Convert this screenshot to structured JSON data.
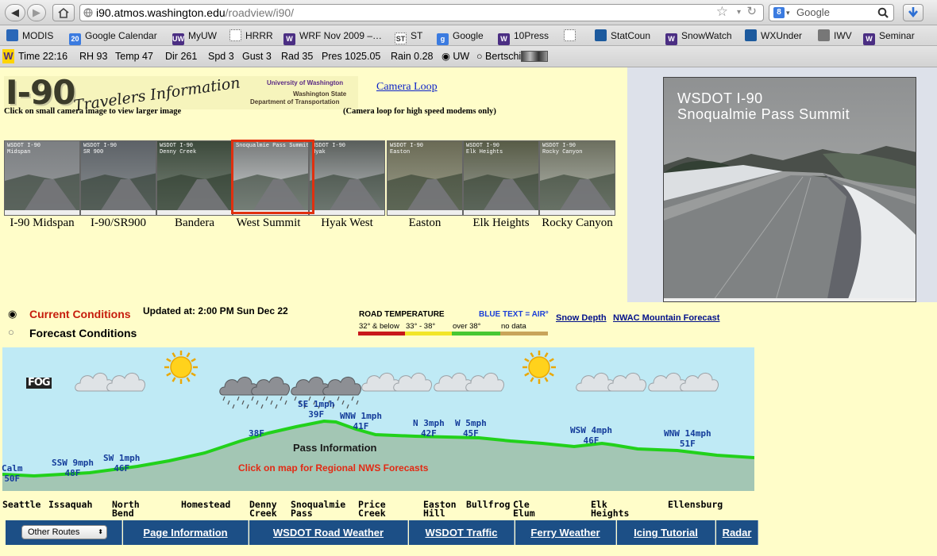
{
  "browser": {
    "url_host": "i90.atmos.washington.edu",
    "url_path": "/roadview/i90/",
    "search_placeholder": "Google"
  },
  "bookmarks": [
    {
      "label": "MODIS",
      "icon": "modis-icon",
      "color": "#2a67b8"
    },
    {
      "label": "Google Calendar",
      "icon": "calendar-icon",
      "color": "#3b7be0",
      "badge": "20"
    },
    {
      "label": "MyUW",
      "icon": "uw-icon",
      "color": "#4b2e83",
      "badge": "UW"
    },
    {
      "label": "HRRR",
      "icon": "dotted-page-icon",
      "color": "#ffffff"
    },
    {
      "label": "WRF Nov 2009 –…",
      "icon": "uw-w-icon",
      "color": "#4b2e83",
      "badge": "W"
    },
    {
      "label": "ST",
      "icon": "st-icon",
      "color": "#ffffff",
      "badge": "ST"
    },
    {
      "label": "Google",
      "icon": "google-icon",
      "color": "#3b7be0",
      "badge": "g"
    },
    {
      "label": "10Press",
      "icon": "uw-w-icon",
      "color": "#4b2e83",
      "badge": "W"
    },
    {
      "label": "",
      "icon": "dotted-page-icon",
      "color": "#ffffff"
    },
    {
      "label": "StatCoun",
      "icon": "statcounter-icon",
      "color": "#1c5a9e"
    },
    {
      "label": "SnowWatch",
      "icon": "uw-w-icon",
      "color": "#4b2e83",
      "badge": "W"
    },
    {
      "label": "WXUnder",
      "icon": "wunderground-icon",
      "color": "#1c5a9e"
    },
    {
      "label": "IWV",
      "icon": "iwv-icon",
      "color": "#777777"
    },
    {
      "label": "Seminar",
      "icon": "uw-w-icon",
      "color": "#4b2e83",
      "badge": "W"
    }
  ],
  "weather_bar": {
    "time": "Time 22:16",
    "rh": "RH 93",
    "temp": "Temp 47",
    "dir": "Dir 261",
    "spd": "Spd 3",
    "gust": "Gust 3",
    "rad": "Rad 35",
    "pres": "Pres 1025.05",
    "rain": "Rain 0.28",
    "opt_uw": "UW",
    "opt_bertschi": "Bertschi"
  },
  "header": {
    "logo_text": "I-90",
    "logo_script": "Travelers Information",
    "org_uw": "University of Washington",
    "org_wsdot_1": "Washington State",
    "org_wsdot_2": "Department of Transportation",
    "camera_loop_link": "Camera Loop",
    "click_hint": "Click on small camera image to view larger image",
    "camera_loop_hint": "(Camera loop for high speed modems only)"
  },
  "cameras": [
    {
      "label": "I-90 Midspan",
      "overlay": "WSDOT I-90\nMidspan"
    },
    {
      "label": "I-90/SR900",
      "overlay": "WSDOT I-90\nSR 900"
    },
    {
      "label": "Bandera",
      "overlay": "WSDOT I-90\nDenny Creek"
    },
    {
      "label": "West Summit",
      "overlay": "Snoqualmie Pass Summit"
    },
    {
      "label": "Hyak West",
      "overlay": "WSDOT I-90\nHyak"
    },
    {
      "label": "Easton",
      "overlay": "WSDOT I-90\nEaston"
    },
    {
      "label": "Elk Heights",
      "overlay": "WSDOT I-90\nElk Heights"
    },
    {
      "label": "Rocky Canyon",
      "overlay": "WSDOT I-90\nRocky Canyon"
    }
  ],
  "large_camera": {
    "line1": "WSDOT   I-90",
    "line2": "Snoqualmie Pass Summit"
  },
  "conditions": {
    "current_label": "Current Conditions",
    "forecast_label": "Forecast Conditions",
    "updated": "Updated at: 2:00 PM Sun Dec 22"
  },
  "legend": {
    "title": "ROAD TEMPERATURE",
    "blue_text": "BLUE TEXT = AIR°",
    "items": [
      {
        "label": "32° & below",
        "color": "#c8171b"
      },
      {
        "label": "33° - 38°",
        "color": "#f2e528"
      },
      {
        "label": "over 38°",
        "color": "#47c733"
      },
      {
        "label": "no data",
        "color": "#c8a45a"
      }
    ]
  },
  "links": {
    "snow_depth": "Snow Depth",
    "nwac": "NWAC Mountain Forecast"
  },
  "map": {
    "fog": "FOG",
    "pass_info": "Pass Information",
    "click_nws": "Click on map for Regional NWS Forecasts",
    "observations": [
      {
        "wind": "Calm",
        "temp": "50F"
      },
      {
        "wind": "SSW 9mph",
        "temp": "48F"
      },
      {
        "wind": "SW 1mph",
        "temp": "46F"
      },
      {
        "wind": "",
        "temp": "38F"
      },
      {
        "wind": "SE 1mph",
        "temp": "39F"
      },
      {
        "wind": "WNW 1mph",
        "temp": "41F"
      },
      {
        "wind": "N 3mph",
        "temp": "42F"
      },
      {
        "wind": "W 5mph",
        "temp": "45F"
      },
      {
        "wind": "WSW 4mph",
        "temp": "46F"
      },
      {
        "wind": "WNW 14mph",
        "temp": "51F"
      }
    ],
    "cities": [
      "Seattle",
      "Issaquah",
      "North\nBend",
      "Homestead",
      "Denny\nCreek",
      "Snoqualmie\nPass",
      "Price\nCreek",
      "Easton\nHill",
      "Bullfrog",
      "Cle\nElum",
      "Elk\nHeights",
      "Ellensburg"
    ]
  },
  "bottom_nav": {
    "routes_select": "Other Routes",
    "items": [
      "Page Information",
      "WSDOT Road Weather",
      "WSDOT Traffic",
      "Ferry Weather",
      "Icing Tutorial",
      "Radar"
    ]
  }
}
